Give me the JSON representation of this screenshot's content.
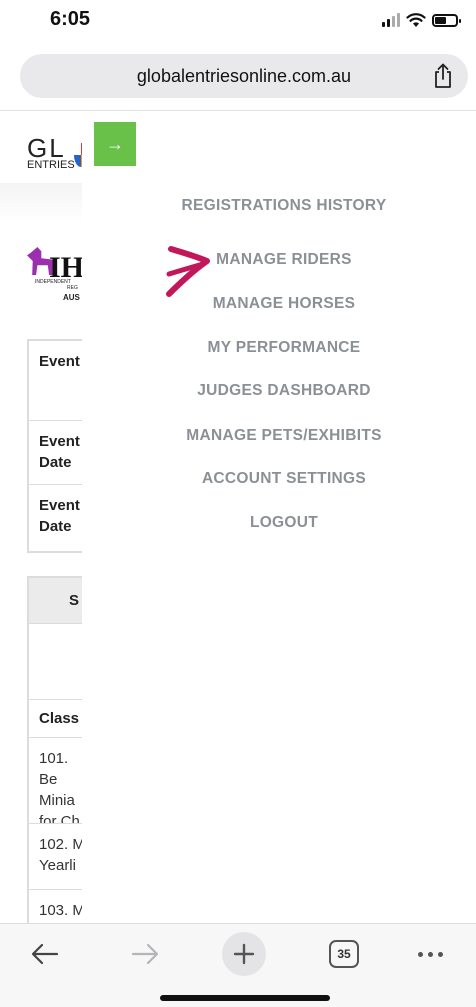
{
  "status_bar": {
    "time": "6:05"
  },
  "browser": {
    "url": "globalentriesonline.com.au",
    "tab_count": "35"
  },
  "background_page": {
    "logo_letters": "GL",
    "logo_sub": "ENTRIES",
    "ihm_letters": "IHM",
    "ihm_line1": "INDEPENDENT",
    "ihm_line2": "REG",
    "ihm_line3": "AUS",
    "info_rows": [
      "Event",
      "Event Date",
      "Event Date"
    ],
    "classes_header": "S",
    "classes_label": "Class",
    "class_items": [
      "101. Be Minia for Ch",
      "102. M Yearli",
      "103. M"
    ]
  },
  "menu": {
    "toggle_icon": "→",
    "items": [
      "REGISTRATIONS HISTORY",
      "MANAGE RIDERS",
      "MANAGE HORSES",
      "MY PERFORMANCE",
      "JUDGES DASHBOARD",
      "MANAGE PETS/EXHIBITS",
      "ACCOUNT SETTINGS",
      "LOGOUT"
    ]
  },
  "colors": {
    "menu_text": "#8b9096",
    "toggle_green": "#69c14a",
    "annotation_magenta": "#c2185b"
  },
  "icons": {
    "share": "share-icon",
    "back": "back-arrow-icon",
    "forward": "forward-arrow-icon",
    "new_tab": "plus-icon",
    "tabs": "tabs-icon",
    "more": "more-dots-icon"
  }
}
